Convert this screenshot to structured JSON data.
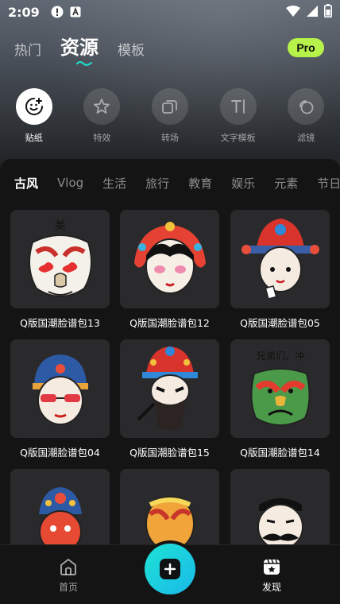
{
  "status_bar": {
    "time": "2:09"
  },
  "top_tabs": [
    {
      "label": "热门",
      "active": false
    },
    {
      "label": "资源",
      "active": true
    },
    {
      "label": "模板",
      "active": false
    }
  ],
  "pro_badge": "Pro",
  "tools": [
    {
      "label": "贴纸",
      "icon": "sticker-smile-icon",
      "active": true
    },
    {
      "label": "特效",
      "icon": "sparkle-star-icon",
      "active": false
    },
    {
      "label": "转场",
      "icon": "transition-squares-icon",
      "active": false
    },
    {
      "label": "文字模板",
      "icon": "text-template-icon",
      "active": false
    },
    {
      "label": "滤镜",
      "icon": "filter-circles-icon",
      "active": false
    }
  ],
  "categories": [
    {
      "label": "古风",
      "active": true
    },
    {
      "label": "Vlog",
      "active": false
    },
    {
      "label": "生活",
      "active": false
    },
    {
      "label": "旅行",
      "active": false
    },
    {
      "label": "教育",
      "active": false
    },
    {
      "label": "娱乐",
      "active": false
    },
    {
      "label": "元素",
      "active": false
    },
    {
      "label": "节日",
      "active": false
    }
  ],
  "stickers": [
    {
      "name": "Q版国潮脸谱包13",
      "sticker_text": "美",
      "art": "white-mask-hearts"
    },
    {
      "name": "Q版国潮脸谱包12",
      "art": "black-hair-pink-eyes"
    },
    {
      "name": "Q版国潮脸谱包05",
      "art": "red-crown-lady"
    },
    {
      "name": "Q版国潮脸谱包04",
      "art": "blue-hat-sunglasses"
    },
    {
      "name": "Q版国潮脸谱包15",
      "art": "bearded-general"
    },
    {
      "name": "Q版国潮脸谱包14",
      "sticker_text": "兄弟们，冲",
      "art": "green-red-mask"
    },
    {
      "name": "",
      "art": "red-crown-face"
    },
    {
      "name": "",
      "art": "orange-yellow-mask"
    },
    {
      "name": "",
      "art": "white-mask-mustache"
    }
  ],
  "bottom_nav": [
    {
      "label": "首页",
      "icon": "home-icon",
      "active": false
    },
    {
      "label": "发现",
      "icon": "discover-clapper-icon",
      "active": true
    }
  ],
  "colors": {
    "pro_badge": "#b6f24a",
    "fab_gradient_start": "#1ee3d3",
    "fab_gradient_end": "#19b9e9",
    "background": "#141414",
    "card": "#2a2a2c"
  }
}
